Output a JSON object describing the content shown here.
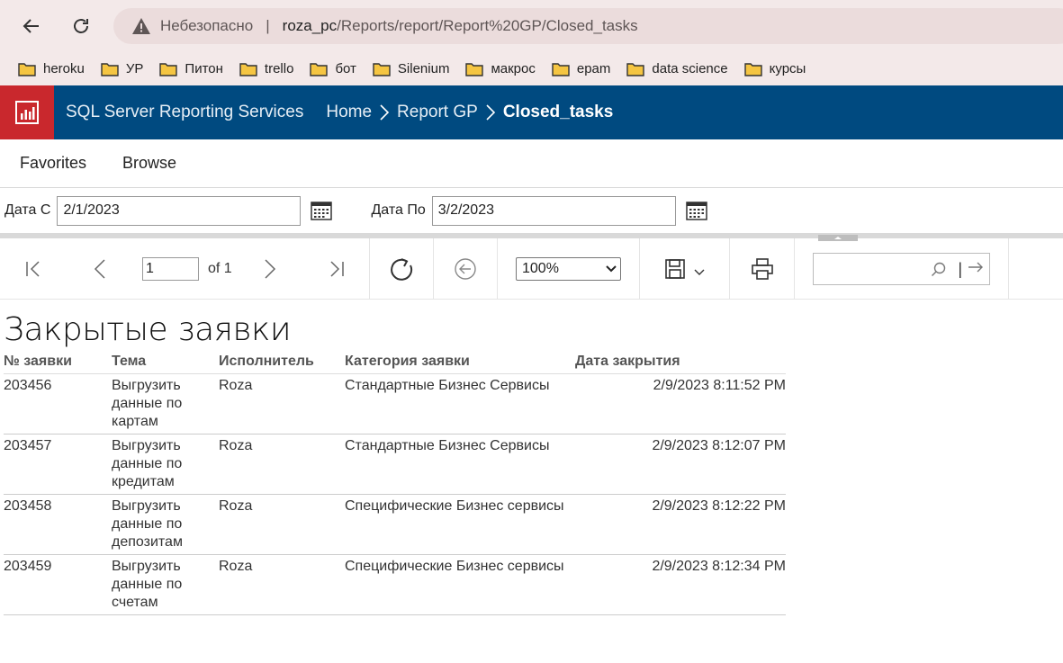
{
  "browser": {
    "insecure_label": "Небезопасно",
    "url_host": "roza_pc",
    "url_path": "/Reports/report/Report%20GP/Closed_tasks",
    "bookmarks": [
      {
        "label": "heroku"
      },
      {
        "label": "УР"
      },
      {
        "label": "Питон"
      },
      {
        "label": "trello"
      },
      {
        "label": "бот"
      },
      {
        "label": "Silenium"
      },
      {
        "label": "макрос"
      },
      {
        "label": "epam"
      },
      {
        "label": "data science"
      },
      {
        "label": "курсы"
      }
    ]
  },
  "header": {
    "app_title": "SQL Server Reporting Services",
    "breadcrumbs": [
      "Home",
      "Report GP",
      "Closed_tasks"
    ]
  },
  "menu": {
    "favorites": "Favorites",
    "browse": "Browse"
  },
  "params": {
    "date_from_label": "Дата С",
    "date_from_value": "2/1/2023",
    "date_to_label": "Дата По",
    "date_to_value": "3/2/2023"
  },
  "toolbar": {
    "page_value": "1",
    "of_label": "of 1",
    "zoom_value": "100%"
  },
  "report": {
    "title": "Закрытые заявки",
    "columns": [
      "№ заявки",
      "Тема",
      "Исполнитель",
      "Категория заявки",
      "Дата закрытия"
    ],
    "rows": [
      {
        "id": "203456",
        "topic": "Выгрузить данные по картам",
        "assignee": "Roza",
        "category": "Стандартные Бизнес Сервисы",
        "closed": "2/9/2023 8:11:52 PM"
      },
      {
        "id": "203457",
        "topic": "Выгрузить данные по кредитам",
        "assignee": "Roza",
        "category": "Стандартные Бизнес Сервисы",
        "closed": "2/9/2023 8:12:07 PM"
      },
      {
        "id": "203458",
        "topic": "Выгрузить данные по депозитам",
        "assignee": "Roza",
        "category": "Специфические Бизнес сервисы",
        "closed": "2/9/2023 8:12:22 PM"
      },
      {
        "id": "203459",
        "topic": "Выгрузить данные по счетам",
        "assignee": "Roza",
        "category": "Специфические Бизнес сервисы",
        "closed": "2/9/2023 8:12:34 PM"
      }
    ]
  },
  "colors": {
    "header_bg": "#004a80",
    "logo_bg": "#c9282d",
    "browser_bg": "#f3e9e9",
    "folder_fill": "#f5c542"
  }
}
